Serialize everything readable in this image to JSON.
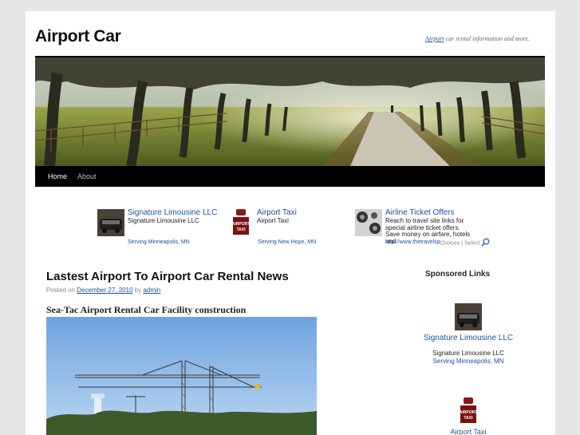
{
  "site": {
    "title": "Airport Car",
    "tagline_link": "Airport",
    "tagline_rest": " car rental information and more."
  },
  "nav": {
    "items": [
      {
        "label": "Home",
        "active": true
      },
      {
        "label": "About",
        "active": false
      }
    ]
  },
  "top_ads": [
    {
      "title": "Signature Limousine LLC",
      "description": "Signature Limousine LLC",
      "url": "Serving Minneapolis, MN",
      "icon": "limousine-thumbnail"
    },
    {
      "title": "Airport Taxi",
      "description": "Airport Taxi",
      "url": "Serving New Hope, MN",
      "icon": "airport-taxi-sign"
    },
    {
      "title": "Airline Ticket Offers",
      "description": "Reach to travel site links for special airline ticket offers. Save money on airfare, hotels and",
      "url": "http://www.thetravelsp",
      "icon": "airline-thumbnail"
    }
  ],
  "ad_choices": {
    "label": "Choices | Select",
    "icon": "search-icon"
  },
  "post": {
    "title": "Lastest Airport To Airport Car Rental News",
    "posted_on": "Posted on ",
    "date": "December 27, 2010",
    "by": " by ",
    "author": "admin",
    "subheading": "Sea-Tac Airport Rental Car Facility construction"
  },
  "sidebar": {
    "widget_title": "Sponsored Links",
    "ads": [
      {
        "title": "Signature Limousine LLC",
        "description": "Signature Limousine LLC",
        "url": "Serving Minneapolis, MN",
        "icon": "limousine-thumbnail"
      },
      {
        "title": "Airport Taxi",
        "icon": "airport-taxi-sign"
      }
    ]
  },
  "colors": {
    "link": "#1b52a7",
    "nav_background": "#000000",
    "page_background": "#e7e7e7"
  }
}
